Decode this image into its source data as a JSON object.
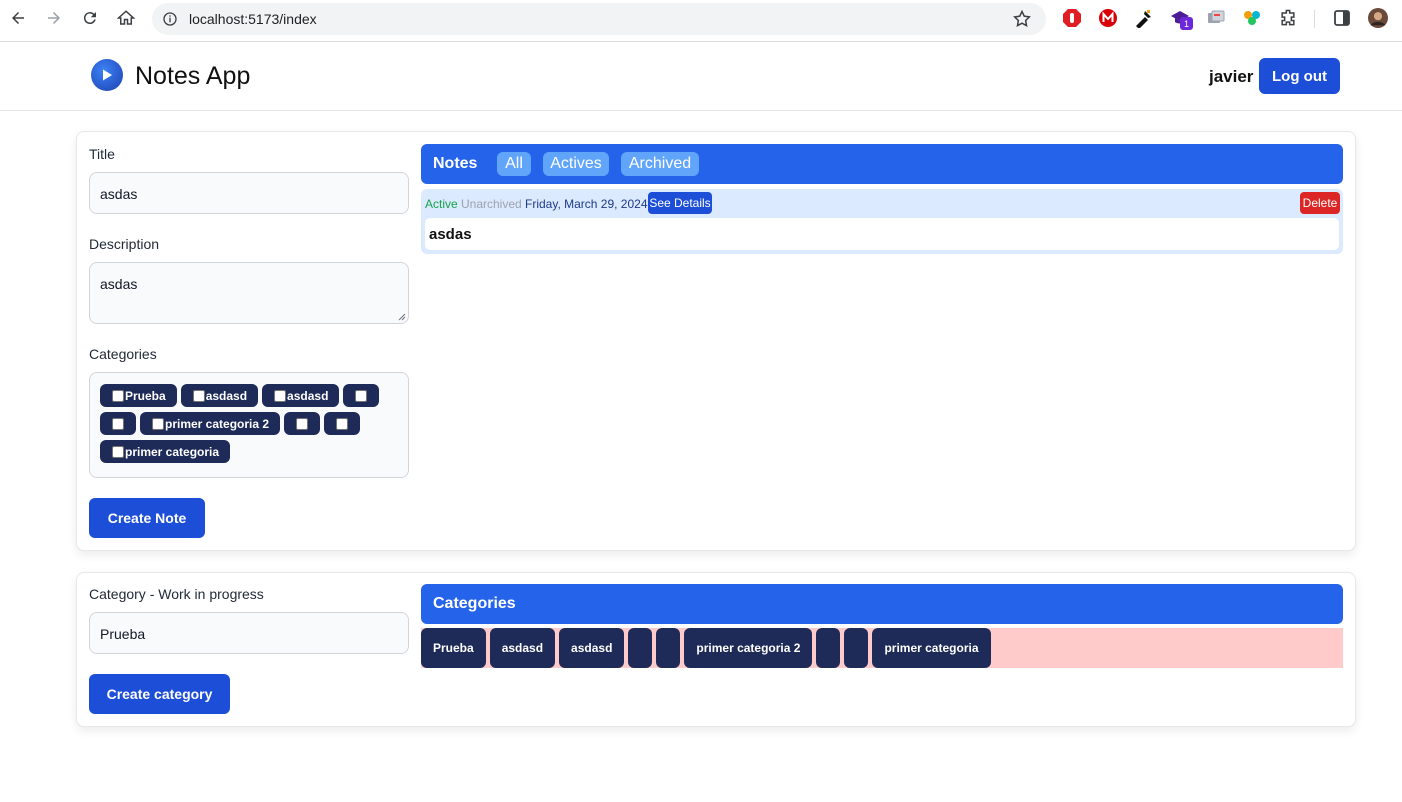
{
  "browser": {
    "url": "localhost:5173/index",
    "extension_badge": "1"
  },
  "header": {
    "app_title": "Notes App",
    "username": "javier",
    "logout_label": "Log out"
  },
  "note_form": {
    "title_label": "Title",
    "title_value": "asdas",
    "description_label": "Description",
    "description_value": "asdas",
    "categories_label": "Categories",
    "category_options": [
      "Prueba",
      "asdasd",
      "asdasd",
      "",
      "",
      "primer categoria 2",
      "",
      "",
      "primer categoria"
    ],
    "create_button": "Create Note"
  },
  "notes_panel": {
    "title": "Notes",
    "filters": [
      "All",
      "Actives",
      "Archived"
    ],
    "notes": [
      {
        "status": "Active",
        "archive_status": "Unarchived",
        "date": "Friday, March 29, 2024",
        "details_label": "See Details",
        "delete_label": "Delete",
        "title": "asdas"
      }
    ]
  },
  "category_form": {
    "label": "Category - Work in progress",
    "value": "Prueba",
    "create_button": "Create category"
  },
  "categories_panel": {
    "title": "Categories",
    "items": [
      "Prueba",
      "asdasd",
      "asdasd",
      "",
      "",
      "primer categoria 2",
      "",
      "",
      "primer categoria"
    ]
  },
  "colors": {
    "primary": "#2563eb",
    "button": "#1d4ed8",
    "chip": "#1e2a57",
    "danger": "#dc2626",
    "active_text": "#16a34a",
    "strip_bg": "#fecaca"
  }
}
